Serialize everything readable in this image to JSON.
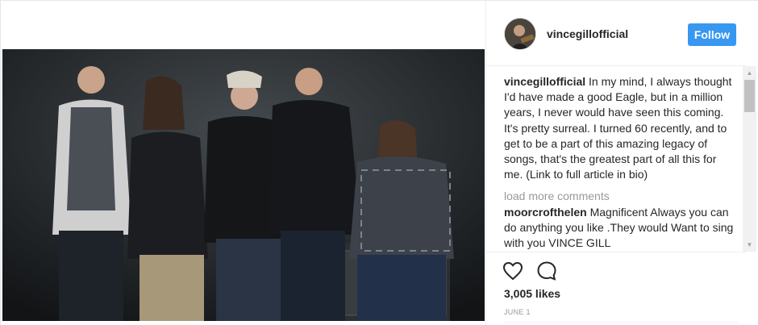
{
  "post": {
    "username": "vincegillofficial",
    "follow_label": "Follow",
    "caption_user": "vincegillofficial",
    "caption_text": "In my mind, I always thought I'd have made a good Eagle, but in a million years, I never would have seen this coming. It's pretty surreal. I turned 60 recently, and to get to be a part of this amazing legacy of songs, that's the greatest part of all this for me. (Link to full article in bio)",
    "load_more_label": "load more comments",
    "comment_user": "moorcrofthelen",
    "comment_text": "Magnificent Always you can do anything you like .They would Want to sing with you VINCE GILL",
    "likes_text": "3,005 likes",
    "date_text": "JUNE 1"
  },
  "icons": {
    "like": "heart-icon",
    "comment": "speech-bubble-icon",
    "scroll_up": "triangle-up-icon",
    "scroll_down": "triangle-down-icon"
  },
  "colors": {
    "follow_button": "#3897f0",
    "muted_text": "#999999",
    "photo_background": "#1a1d20"
  }
}
